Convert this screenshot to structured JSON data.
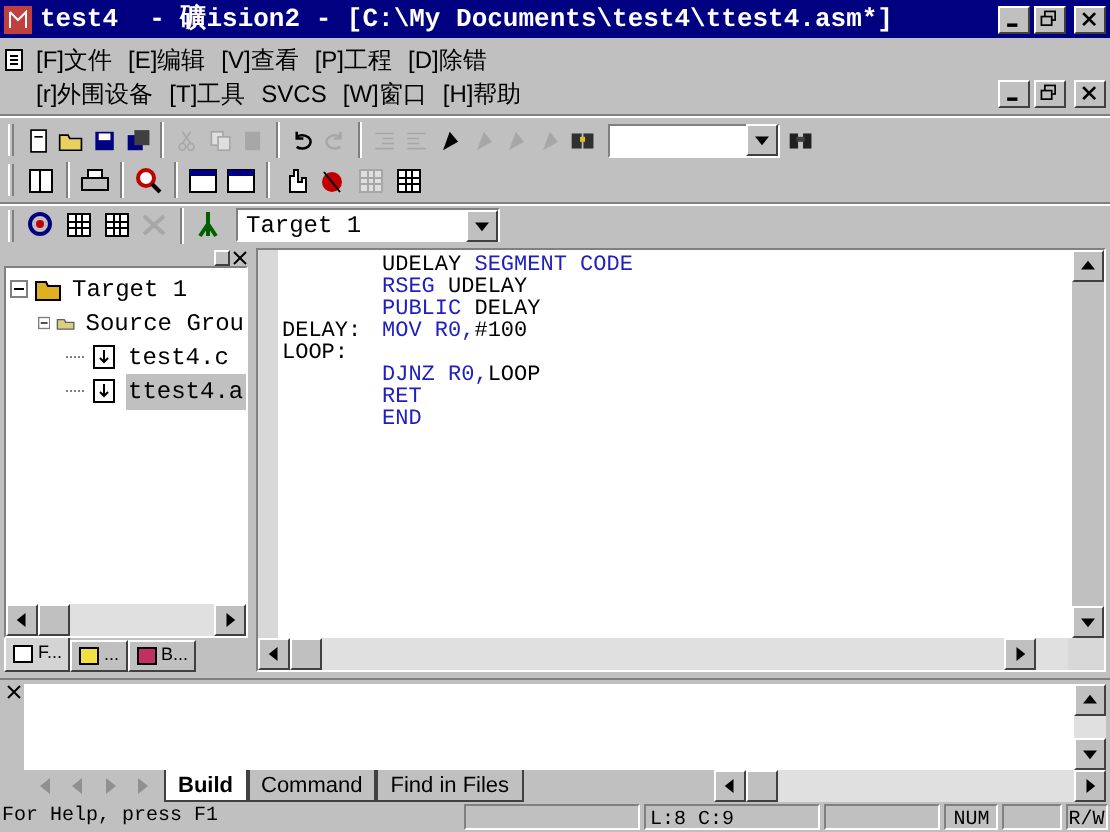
{
  "window": {
    "title": "test4  - 礦ision2 - [C:\\My Documents\\test4\\ttest4.asm*]"
  },
  "menu_rows": [
    [
      "[F]文件",
      "[E]编辑",
      "[V]查看",
      "[P]工程",
      "[D]除错"
    ],
    [
      "[r]外围设备",
      "[T]工具",
      "SVCS",
      "[W]窗口",
      "[H]帮助"
    ]
  ],
  "toolbar_1": [
    {
      "kind": "new",
      "disabled": false
    },
    {
      "kind": "open",
      "disabled": false
    },
    {
      "kind": "save",
      "disabled": false
    },
    {
      "kind": "saveall",
      "disabled": false
    },
    {
      "kind": "sep"
    },
    {
      "kind": "cut",
      "disabled": true
    },
    {
      "kind": "copy",
      "disabled": true
    },
    {
      "kind": "paste",
      "disabled": true
    },
    {
      "kind": "sep"
    },
    {
      "kind": "undo",
      "disabled": false
    },
    {
      "kind": "redo",
      "disabled": true
    },
    {
      "kind": "sep"
    },
    {
      "kind": "indent",
      "disabled": true
    },
    {
      "kind": "outdent",
      "disabled": true
    },
    {
      "kind": "bookmark",
      "disabled": false
    },
    {
      "kind": "bookmark",
      "disabled": true
    },
    {
      "kind": "bookmark",
      "disabled": true
    },
    {
      "kind": "bookmark",
      "disabled": true
    },
    {
      "kind": "find",
      "disabled": false
    }
  ],
  "toolbar_2": [
    {
      "kind": "doc",
      "disabled": false
    },
    {
      "kind": "sep"
    },
    {
      "kind": "print",
      "disabled": false
    },
    {
      "kind": "sep"
    },
    {
      "kind": "zoom",
      "disabled": false
    },
    {
      "kind": "sep"
    },
    {
      "kind": "window",
      "disabled": false
    },
    {
      "kind": "window",
      "disabled": false
    },
    {
      "kind": "sep"
    },
    {
      "kind": "hand",
      "disabled": false
    },
    {
      "kind": "debug",
      "disabled": false
    },
    {
      "kind": "grid",
      "disabled": true
    },
    {
      "kind": "grid",
      "disabled": false
    }
  ],
  "toolbar_3": [
    {
      "kind": "build",
      "disabled": false
    },
    {
      "kind": "grid",
      "disabled": false
    },
    {
      "kind": "grid",
      "disabled": false
    },
    {
      "kind": "stop",
      "disabled": true
    },
    {
      "kind": "sep"
    },
    {
      "kind": "target",
      "disabled": false
    }
  ],
  "target_combo": {
    "value": "Target 1"
  },
  "project_tree": [
    {
      "label": "Target 1",
      "kind": "target",
      "expanded": true,
      "selected": false,
      "children": [
        {
          "label": "Source Grou",
          "kind": "folder",
          "expanded": true,
          "selected": false,
          "children": [
            {
              "label": "test4.c",
              "kind": "file",
              "selected": false
            },
            {
              "label": "ttest4.a",
              "kind": "file",
              "selected": true
            }
          ]
        }
      ]
    }
  ],
  "project_tabs": [
    {
      "label": "F...",
      "selected": true
    },
    {
      "label": "...",
      "selected": false
    },
    {
      "label": "B...",
      "selected": false
    }
  ],
  "editor": {
    "lines": [
      {
        "code": [
          {
            "text": "UDELAY ",
            "kind": "plain"
          },
          {
            "text": "SEGMENT CODE",
            "kind": "keyword"
          }
        ]
      },
      {
        "code": [
          {
            "text": "RSEG ",
            "kind": "keyword"
          },
          {
            "text": "UDELAY",
            "kind": "plain"
          }
        ]
      },
      {
        "code": [
          {
            "text": "PUBLIC ",
            "kind": "keyword"
          },
          {
            "text": "DELAY",
            "kind": "plain"
          }
        ]
      },
      {
        "label": "DELAY:",
        "code": [
          {
            "text": "MOV R0,",
            "kind": "keyword"
          },
          {
            "text": "#100",
            "kind": "plain"
          }
        ]
      },
      {
        "label": "LOOP:"
      },
      {
        "code": [
          {
            "text": "DJNZ R0,",
            "kind": "keyword"
          },
          {
            "text": "LOOP",
            "kind": "plain"
          }
        ]
      },
      {
        "code": [
          {
            "text": "RET",
            "kind": "keyword"
          }
        ]
      },
      {
        "code": [
          {
            "text": "END",
            "kind": "keyword"
          }
        ]
      }
    ]
  },
  "output_tabs": [
    {
      "label": "Build",
      "selected": true
    },
    {
      "label": "Command",
      "selected": false
    },
    {
      "label": "Find in Files",
      "selected": false
    }
  ],
  "status_bar": {
    "help": "For Help, press F1",
    "position": "L:8 C:9",
    "num": "NUM",
    "mode": "R/W"
  }
}
